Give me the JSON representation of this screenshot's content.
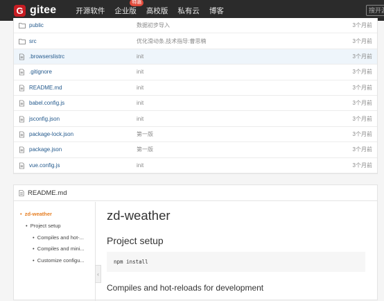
{
  "header": {
    "logo_letter": "G",
    "logo_text": "gitee",
    "nav": [
      {
        "label": "开源软件"
      },
      {
        "label": "企业版",
        "badge": "特惠"
      },
      {
        "label": "高校版"
      },
      {
        "label": "私有云"
      },
      {
        "label": "博客"
      }
    ],
    "search_placeholder": "搜开源"
  },
  "files": [
    {
      "name": "public",
      "type": "folder",
      "commit": "数据初步导入",
      "time": "3个月前"
    },
    {
      "name": "src",
      "type": "folder",
      "commit": "优化滑动条,技术指导:曹思楠",
      "time": "3个月前"
    },
    {
      "name": ".browserslistrc",
      "type": "file",
      "commit": "init",
      "time": "3个月前"
    },
    {
      "name": ".gitignore",
      "type": "file",
      "commit": "init",
      "time": "3个月前"
    },
    {
      "name": "README.md",
      "type": "file",
      "commit": "init",
      "time": "3个月前"
    },
    {
      "name": "babel.config.js",
      "type": "file",
      "commit": "init",
      "time": "3个月前"
    },
    {
      "name": "jsconfig.json",
      "type": "file",
      "commit": "init",
      "time": "3个月前"
    },
    {
      "name": "package-lock.json",
      "type": "file",
      "commit": "第一版",
      "time": "3个月前"
    },
    {
      "name": "package.json",
      "type": "file",
      "commit": "第一版",
      "time": "3个月前"
    },
    {
      "name": "vue.config.js",
      "type": "file",
      "commit": "init",
      "time": "3个月前"
    }
  ],
  "readme": {
    "title": "README.md",
    "toc": [
      {
        "label": "zd-weather",
        "level": 0,
        "active": true
      },
      {
        "label": "Project setup",
        "level": 1
      },
      {
        "label": "Compiles and hot-...",
        "level": 2
      },
      {
        "label": "Compiles and mini...",
        "level": 2
      },
      {
        "label": "Customize configu...",
        "level": 2
      }
    ],
    "h1": "zd-weather",
    "h2": "Project setup",
    "code": "npm install",
    "h3": "Compiles and hot-reloads for development"
  }
}
